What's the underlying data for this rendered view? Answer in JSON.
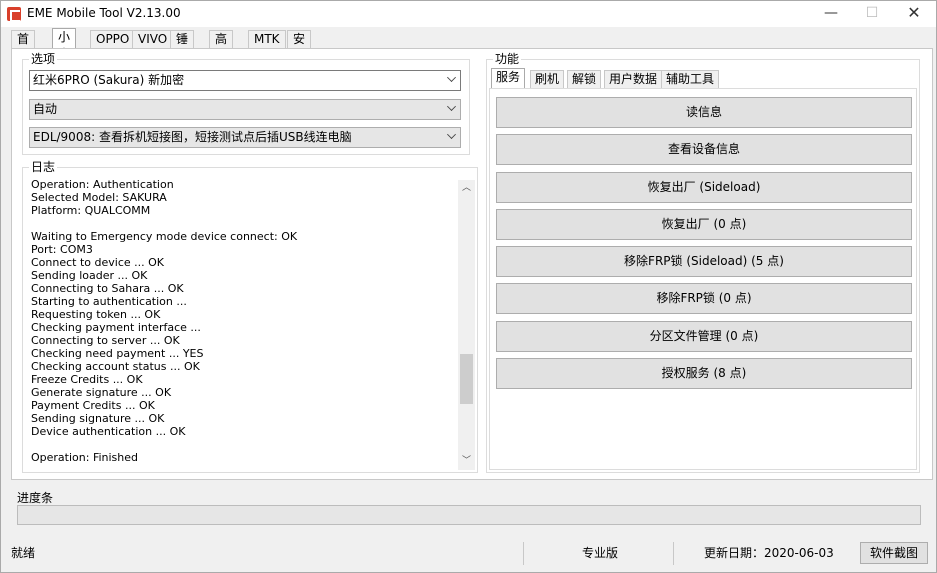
{
  "window": {
    "title": "EME Mobile Tool V2.13.00",
    "minimize": "—",
    "maximize": "☐",
    "close": "✕"
  },
  "tabs": [
    "首页",
    "小米",
    "OPPO",
    "VIVO",
    "锤子",
    "高通",
    "MTK",
    "安卓"
  ],
  "active_tab": "小米",
  "options": {
    "label": "选项",
    "model_select": "红米6PRO (Sakura) 新加密",
    "mode_select": "自动",
    "edl_select": "EDL/9008: 查看拆机短接图，短接测试点后插USB线连电脑"
  },
  "log": {
    "label": "日志",
    "lines": "Operation: Authentication\nSelected Model: SAKURA\nPlatform: QUALCOMM\n\nWaiting to Emergency mode device connect: OK\nPort: COM3\nConnect to device ... OK\nSending loader ... OK\nConnecting to Sahara ... OK\nStarting to authentication ...\nRequesting token ... OK\nChecking payment interface ...\nConnecting to server ... OK\nChecking need payment ... YES\nChecking account status ... OK\nFreeze Credits ... OK\nGenerate signature ... OK\nPayment Credits ... OK\nSending signature ... OK\nDevice authentication ... OK\n\nOperation: Finished"
  },
  "functions": {
    "label": "功能",
    "tabs": [
      "服务",
      "刷机",
      "解锁",
      "用户数据",
      "辅助工具"
    ],
    "active_tab": "服务",
    "buttons": [
      "读信息",
      "查看设备信息",
      "恢复出厂 (Sideload)",
      "恢复出厂 (0 点)",
      "移除FRP锁 (Sideload) (5 点)",
      "移除FRP锁 (0 点)",
      "分区文件管理 (0 点)",
      "授权服务 (8 点)"
    ]
  },
  "progress": {
    "label": "进度条",
    "value": 0
  },
  "status": {
    "state": "就绪",
    "edition": "专业版",
    "update_date": "更新日期：2020-06-03",
    "capture_button": "软件截图"
  }
}
